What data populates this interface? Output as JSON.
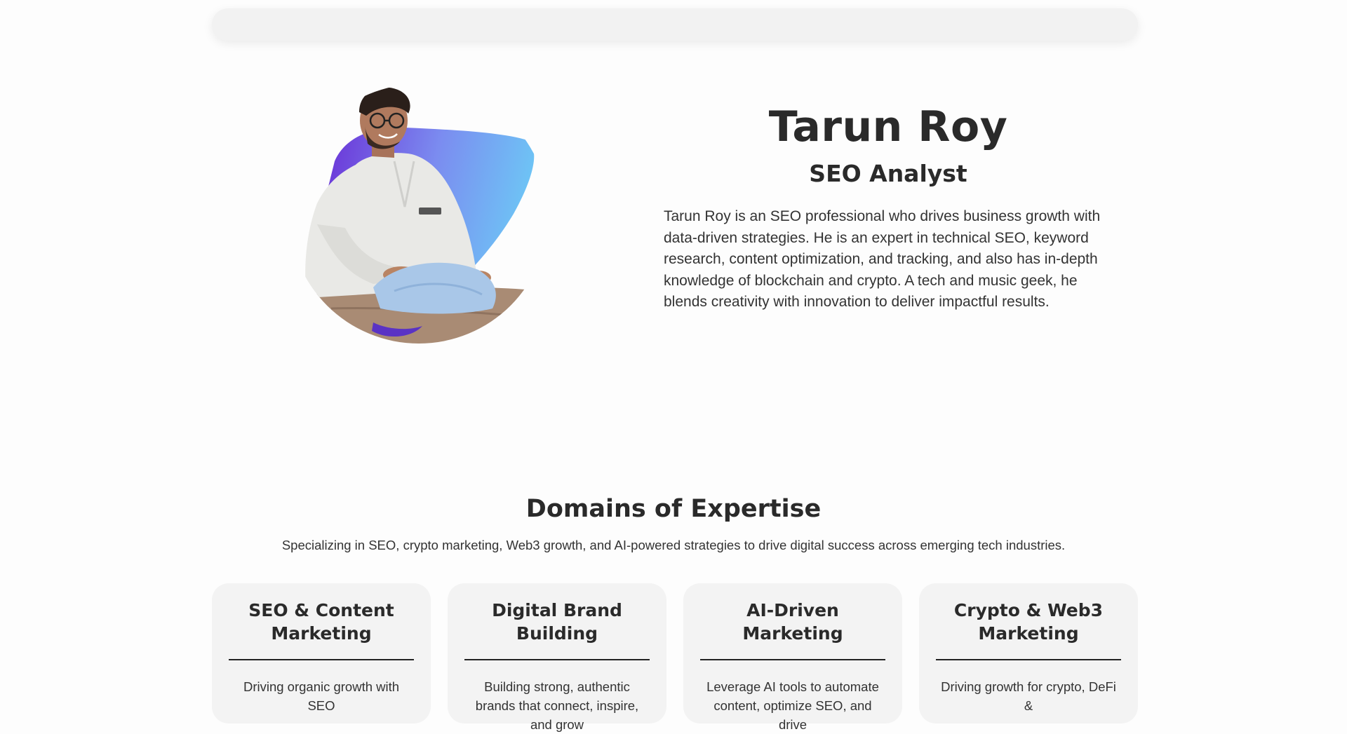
{
  "hero": {
    "name": "Tarun Roy",
    "role": "SEO Analyst",
    "bio": "Tarun Roy is an SEO professional who drives business growth with data-driven strategies. He is an expert in technical SEO, keyword research, content optimization, and tracking, and also has in-depth knowledge of blockchain and crypto. A tech and music geek, he blends creativity with innovation to deliver impactful results."
  },
  "domains": {
    "title": "Domains of Expertise",
    "subtitle": "Specializing in SEO, crypto marketing, Web3 growth, and AI-powered strategies to drive digital success across emerging tech industries.",
    "cards": [
      {
        "title": "SEO & Content Marketing",
        "desc": "Driving organic growth with SEO"
      },
      {
        "title": "Digital Brand Building",
        "desc": "Building strong, authentic brands that connect, inspire, and grow"
      },
      {
        "title": "AI-Driven Marketing",
        "desc": "Leverage AI tools to automate content, optimize SEO, and drive"
      },
      {
        "title": "Crypto & Web3 Marketing",
        "desc": "Driving growth for crypto, DeFi &"
      }
    ]
  },
  "colors": {
    "blob_gradient_start": "#6a2fd6",
    "blob_gradient_end": "#6ec3f5",
    "card_background": "#f3f3f3"
  }
}
